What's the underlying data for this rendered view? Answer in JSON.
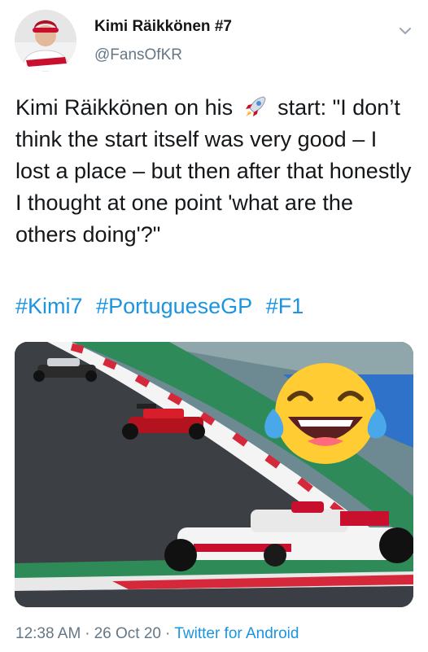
{
  "tweet": {
    "author_name": "Kimi Räikkönen #7",
    "author_handle": "@FansOfKR",
    "text_before_emoji": "Kimi Räikkönen on his",
    "text_after_emoji": "start: \"I don’t think the start itself was very good – I lost a place – but then after that honestly I thought at one point 'what are the others doing'?\"",
    "inline_emoji": "rocket-emoji",
    "hashtags": [
      "#Kimi7",
      "#PortugueseGP",
      "#F1"
    ],
    "media_overlay_emoji": "laughing-tears-emoji",
    "time": "12:38 AM",
    "date": "26 Oct 20",
    "separator": "·",
    "source": "Twitter for Android"
  },
  "colors": {
    "link": "#1b95e0",
    "secondary_text": "#657786",
    "primary_text": "#14171a"
  }
}
